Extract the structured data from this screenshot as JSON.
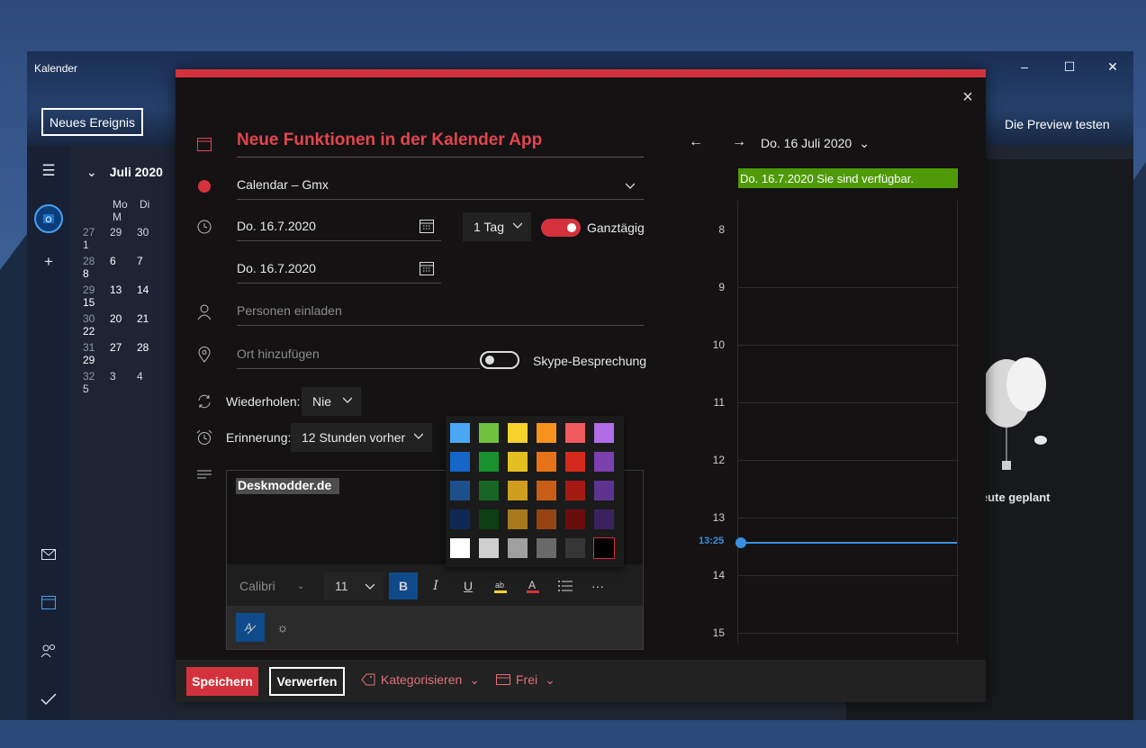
{
  "window": {
    "title": "Kalender",
    "new_event_label": "Neues Ereignis",
    "preview_label": "Die Preview testen",
    "minimize": "–",
    "maximize": "☐",
    "close": "✕"
  },
  "mini_calendar": {
    "month": "Juli 2020",
    "weekdays": [
      "Mo",
      "Di",
      "M"
    ],
    "weeks": [
      {
        "kw": "27",
        "days": [
          "29",
          "30",
          "1"
        ]
      },
      {
        "kw": "28",
        "days": [
          "6",
          "7",
          "8"
        ]
      },
      {
        "kw": "29",
        "days": [
          "13",
          "14",
          "15"
        ]
      },
      {
        "kw": "30",
        "days": [
          "20",
          "21",
          "22"
        ]
      },
      {
        "kw": "31",
        "days": [
          "27",
          "28",
          "29"
        ]
      },
      {
        "kw": "32",
        "days": [
          "3",
          "4",
          "5"
        ]
      }
    ]
  },
  "right_pane": {
    "text": "heute geplant"
  },
  "event": {
    "title": "Neue Funktionen in der Kalender App",
    "calendar": "Calendar – Gmx",
    "start_date": "Do. 16.7.2020",
    "end_date": "Do. 16.7.2020",
    "duration": "1 Tag",
    "all_day_label": "Ganztägig",
    "all_day_on": true,
    "invite_placeholder": "Personen einladen",
    "location_placeholder": "Ort hinzufügen",
    "skype_label": "Skype-Besprechung",
    "skype_on": false,
    "repeat_label": "Wiederholen:",
    "repeat_value": "Nie",
    "reminder_label": "Erinnerung:",
    "reminder_value": "12 Stunden vorher",
    "body_text": "Deskmodder.de",
    "font_name": "Calibri",
    "font_size": "11",
    "more_label": "···"
  },
  "palette": {
    "rows": [
      [
        "#4ba6f5",
        "#70c13d",
        "#f7d22d",
        "#f7931e",
        "#ee5a5e",
        "#b26de6"
      ],
      [
        "#1566c8",
        "#18912e",
        "#e4bf22",
        "#e67318",
        "#d42a1e",
        "#7c3fae"
      ],
      [
        "#1c4f8b",
        "#176625",
        "#cf9d1f",
        "#c85e16",
        "#a61a14",
        "#5e3390"
      ],
      [
        "#0e2855",
        "#0d3f12",
        "#a8781c",
        "#954412",
        "#6a0d0b",
        "#3d2260"
      ],
      [
        "#ffffff",
        "#cfcfcf",
        "#9f9f9f",
        "#6a6a6a",
        "#363636",
        "#000000"
      ]
    ]
  },
  "day_view": {
    "date_label": "Do. 16 Juli 2020",
    "availability": "Do. 16.7.2020 Sie sind verfügbar.",
    "hours": [
      "8",
      "9",
      "10",
      "11",
      "12",
      "13",
      "14",
      "15"
    ],
    "now_label": "13:25"
  },
  "footer": {
    "save_label": "Speichern",
    "discard_label": "Verwerfen",
    "categorize_label": "Kategorisieren",
    "status_label": "Frei"
  }
}
